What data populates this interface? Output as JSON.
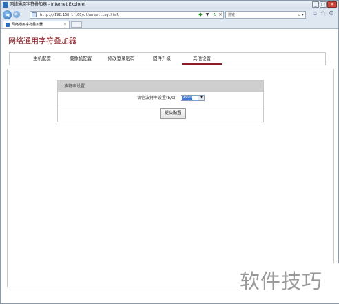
{
  "window": {
    "title": "网络通用字符叠加器 - Internet Explorer",
    "controls": {
      "minimize": "_",
      "maximize": "□",
      "close": "X"
    }
  },
  "browser": {
    "back_glyph": "◄",
    "forward_glyph": "►",
    "url": "http://192.168.1.160/othersetting.html",
    "search_placeholder": "搜索",
    "tab_title": "网络通用字符叠加器",
    "tab_close": "×"
  },
  "page": {
    "brand": "网络通用字符叠加器",
    "menu": [
      {
        "label": "主机配置"
      },
      {
        "label": "摄像机配置"
      },
      {
        "label": "修改登录密码"
      },
      {
        "label": "固件升级"
      },
      {
        "label": "其他设置",
        "active": true
      }
    ],
    "panel": {
      "title": "波特率设置",
      "baud_label": "请信波特率设置(b/s):",
      "baud_value": "9600",
      "submit_label": "提交配置"
    }
  },
  "watermark": "软件技巧",
  "colors": {
    "brand": "#8b1d22",
    "select_highlight": "#3b78d8",
    "panel_header": "#cfcfcf"
  }
}
